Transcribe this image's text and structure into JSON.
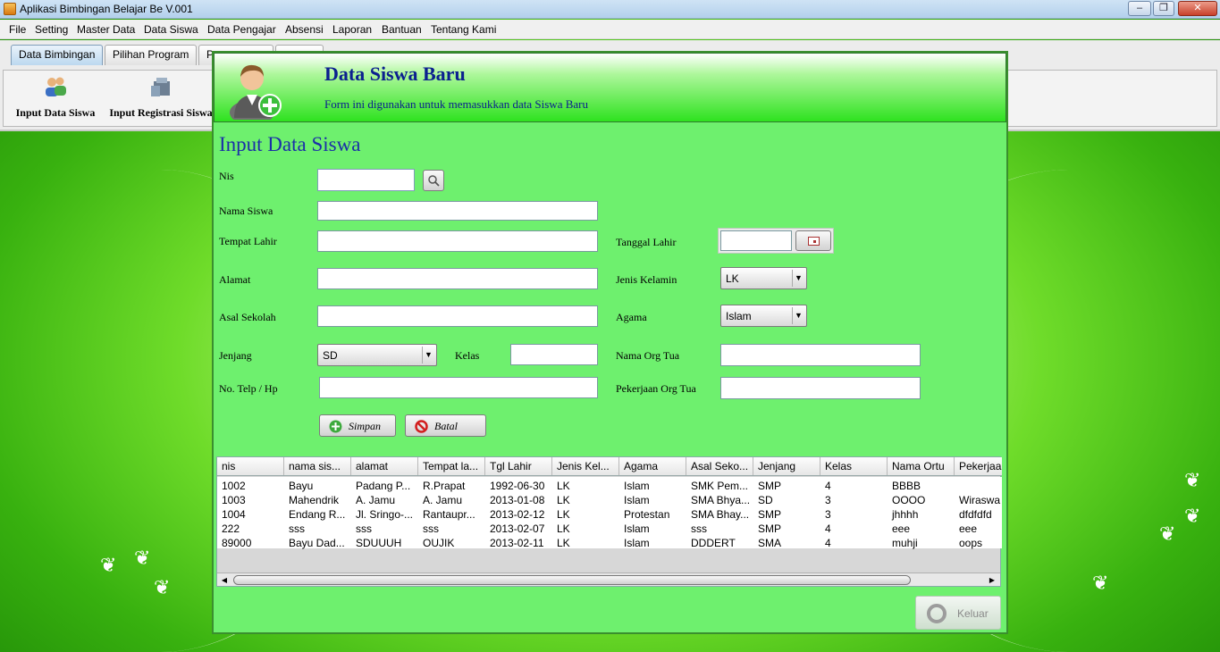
{
  "window": {
    "title": "Aplikasi Bimbingan Belajar Be V.001",
    "min": "–",
    "max": "❐",
    "close": "✕"
  },
  "menu": [
    "File",
    "Setting",
    "Master Data",
    "Data Siswa",
    "Data Pengajar",
    "Absensi",
    "Laporan",
    "Bantuan",
    "Tentang Kami"
  ],
  "tabs": [
    "Data Bimbingan",
    "Pilihan Program",
    "P",
    ""
  ],
  "ribbon": {
    "input_data_siswa": "Input Data Siswa",
    "input_registrasi_siswa": "Input Registrasi Siswa"
  },
  "dialog": {
    "title": "Data Siswa Baru",
    "subtitle": "Form ini digunakan untuk memasukkan data Siswa Baru",
    "form_title": "Input Data Siswa",
    "labels": {
      "nis": "Nis",
      "nama_siswa": "Nama Siswa",
      "tempat_lahir": "Tempat Lahir",
      "alamat": "Alamat",
      "asal_sekolah": "Asal Sekolah",
      "jenjang": "Jenjang",
      "kelas": "Kelas",
      "no_telp": "No. Telp / Hp",
      "tanggal_lahir": "Tanggal Lahir",
      "jenis_kelamin": "Jenis Kelamin",
      "agama": "Agama",
      "nama_org_tua": "Nama Org Tua",
      "pekerjaan_org_tua": "Pekerjaan Org Tua"
    },
    "values": {
      "nis": "",
      "nama_siswa": "",
      "tempat_lahir": "",
      "alamat": "",
      "asal_sekolah": "",
      "kelas": "",
      "no_telp": "",
      "tanggal_lahir": "",
      "nama_org_tua": "",
      "pekerjaan_org_tua": "",
      "jenjang": "SD",
      "jenis_kelamin": "LK",
      "agama": "Islam"
    },
    "buttons": {
      "simpan": "Simpan",
      "batal": "Batal",
      "keluar": "Keluar"
    },
    "table": {
      "columns": [
        "nis",
        "nama sis...",
        "alamat",
        "Tempat la...",
        "Tgl Lahir",
        "Jenis Kel...",
        "Agama",
        "Asal Seko...",
        "Jenjang",
        "Kelas",
        "Nama Ortu",
        "Pekerjaa"
      ],
      "rows": [
        [
          "1002",
          "Bayu",
          "Padang P...",
          "R.Prapat",
          "1992-06-30",
          "LK",
          "Islam",
          "SMK Pem...",
          "SMP",
          "4",
          "BBBB",
          ""
        ],
        [
          "1003",
          "Mahendrik",
          "A. Jamu",
          "A. Jamu",
          "2013-01-08",
          "LK",
          "Islam",
          "SMA Bhya...",
          "SD",
          "3",
          "OOOO",
          "Wiraswa"
        ],
        [
          "1004",
          "Endang R...",
          "Jl. Sringo-...",
          "Rantaupr...",
          "2013-02-12",
          "LK",
          "Protestan",
          "SMA Bhay...",
          "SMP",
          "3",
          "jhhhh",
          "dfdfdfd"
        ],
        [
          "222",
          "sss",
          "sss",
          "sss",
          "2013-02-07",
          "LK",
          "Islam",
          "sss",
          "SMP",
          "4",
          "eee",
          "eee"
        ],
        [
          "89000",
          "Bayu Dad...",
          "SDUUUH",
          "OUJIK",
          "2013-02-11",
          "LK",
          "Islam",
          "DDDERT",
          "SMA",
          "4",
          "muhji",
          "oops"
        ]
      ]
    }
  }
}
